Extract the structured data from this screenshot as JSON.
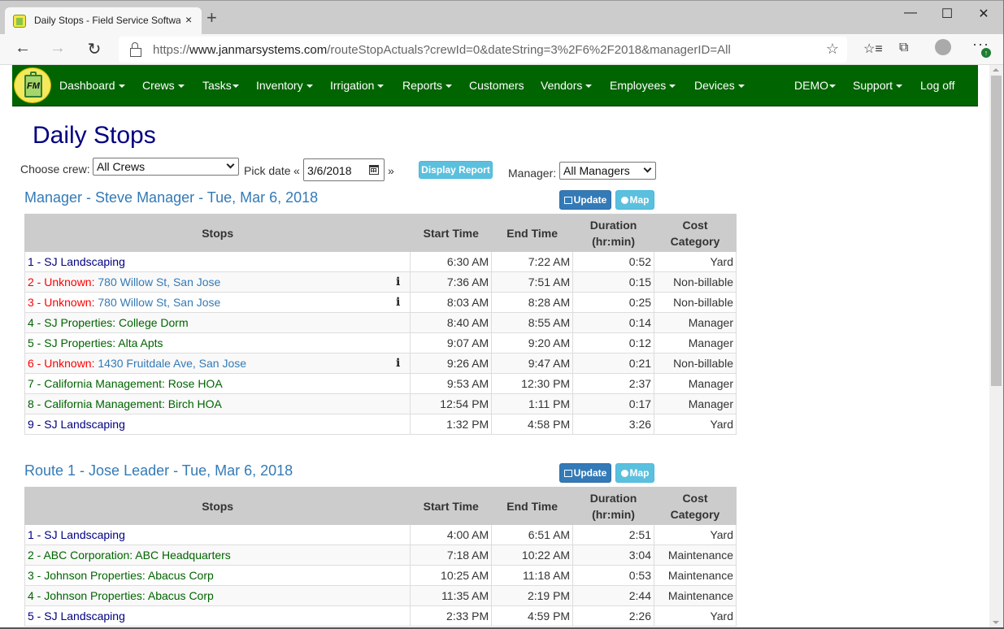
{
  "browser": {
    "tab_title": "Daily Stops - Field Service Software",
    "new_tab": "+",
    "close_tab": "×",
    "window": {
      "minimize": "—",
      "maximize": "☐",
      "close": "✕"
    },
    "nav": {
      "back": "←",
      "forward": "→",
      "reload": "↻"
    },
    "url_scheme": "https://",
    "url_host": "www.janmarsystems.com",
    "url_path": "/routeStopActuals?crewId=0&dateString=3%2F6%2F2018&managerID=All",
    "favorite_icon": "☆",
    "favorites_bar_icon": "☆≡",
    "collections_icon": "⧉",
    "more": "···",
    "update_badge": "↑"
  },
  "navbar": {
    "logo_text": "FM",
    "items": [
      {
        "label": "Dashboard",
        "dropdown": true
      },
      {
        "label": "Crews",
        "dropdown": true
      },
      {
        "label": "Tasks",
        "dropdown": true
      },
      {
        "label": "Inventory",
        "dropdown": true
      },
      {
        "label": "Irrigation",
        "dropdown": true
      },
      {
        "label": "Reports",
        "dropdown": true
      },
      {
        "label": "Customers",
        "dropdown": false
      },
      {
        "label": "Vendors",
        "dropdown": true
      },
      {
        "label": "Employees",
        "dropdown": true
      },
      {
        "label": "Devices",
        "dropdown": true
      },
      {
        "label": "DEMO",
        "dropdown": true
      },
      {
        "label": "Support",
        "dropdown": true
      },
      {
        "label": "Log off",
        "dropdown": false
      }
    ],
    "color": "#006400"
  },
  "page": {
    "title": "Daily Stops",
    "filters": {
      "crew_label": "Choose crew:",
      "crew_value": "All Crews",
      "date_label": "Pick date",
      "prev_arrow": "«",
      "next_arrow": "»",
      "date_value": "3/6/2018",
      "display_button": "Display Report",
      "manager_label": "Manager:",
      "manager_value": "All Managers"
    }
  },
  "table_headers": {
    "stops": "Stops",
    "start": "Start Time",
    "end": "End Time",
    "duration_1": "Duration",
    "duration_2": "(hr:min)",
    "cost_1": "Cost",
    "cost_2": "Category"
  },
  "sections": [
    {
      "title": "Manager - Steve Manager - Tue, Mar 6, 2018",
      "update_label": "Update",
      "map_label": "Map",
      "rows": [
        {
          "type": "yard",
          "prefix": "1 - SJ Landscaping",
          "detail": "",
          "info": false,
          "start": "6:30 AM",
          "end": "7:22 AM",
          "duration": "0:52",
          "category": "Yard"
        },
        {
          "type": "unknown",
          "prefix": "2 - Unknown:",
          "detail": " 780 Willow St, San Jose",
          "info": true,
          "start": "7:36 AM",
          "end": "7:51 AM",
          "duration": "0:15",
          "category": "Non-billable"
        },
        {
          "type": "unknown",
          "prefix": "3 - Unknown:",
          "detail": " 780 Willow St, San Jose",
          "info": true,
          "start": "8:03 AM",
          "end": "8:28 AM",
          "duration": "0:25",
          "category": "Non-billable"
        },
        {
          "type": "customer",
          "prefix": "4 - SJ Properties:  College Dorm",
          "detail": "",
          "info": false,
          "start": "8:40 AM",
          "end": "8:55 AM",
          "duration": "0:14",
          "category": "Manager"
        },
        {
          "type": "customer",
          "prefix": "5 - SJ Properties:  Alta Apts",
          "detail": "",
          "info": false,
          "start": "9:07 AM",
          "end": "9:20 AM",
          "duration": "0:12",
          "category": "Manager"
        },
        {
          "type": "unknown",
          "prefix": "6 - Unknown:",
          "detail": " 1430 Fruitdale Ave, San Jose",
          "info": true,
          "start": "9:26 AM",
          "end": "9:47 AM",
          "duration": "0:21",
          "category": "Non-billable"
        },
        {
          "type": "customer",
          "prefix": "7 - California Management:  Rose HOA",
          "detail": "",
          "info": false,
          "start": "9:53 AM",
          "end": "12:30 PM",
          "duration": "2:37",
          "category": "Manager"
        },
        {
          "type": "customer",
          "prefix": "8 - California Management:  Birch HOA",
          "detail": "",
          "info": false,
          "start": "12:54 PM",
          "end": "1:11 PM",
          "duration": "0:17",
          "category": "Manager"
        },
        {
          "type": "yard",
          "prefix": "9 - SJ Landscaping",
          "detail": "",
          "info": false,
          "start": "1:32 PM",
          "end": "4:58 PM",
          "duration": "3:26",
          "category": "Yard"
        }
      ]
    },
    {
      "title": "Route 1 - Jose Leader - Tue, Mar 6, 2018",
      "update_label": "Update",
      "map_label": "Map",
      "rows": [
        {
          "type": "yard",
          "prefix": "1 - SJ Landscaping",
          "detail": "",
          "info": false,
          "start": "4:00 AM",
          "end": "6:51 AM",
          "duration": "2:51",
          "category": "Yard"
        },
        {
          "type": "customer",
          "prefix": "2 - ABC Corporation:  ABC Headquarters",
          "detail": "",
          "info": false,
          "start": "7:18 AM",
          "end": "10:22 AM",
          "duration": "3:04",
          "category": "Maintenance"
        },
        {
          "type": "customer",
          "prefix": "3 - Johnson Properties:  Abacus Corp",
          "detail": "",
          "info": false,
          "start": "10:25 AM",
          "end": "11:18 AM",
          "duration": "0:53",
          "category": "Maintenance"
        },
        {
          "type": "customer",
          "prefix": "4 - Johnson Properties:  Abacus Corp",
          "detail": "",
          "info": false,
          "start": "11:35 AM",
          "end": "2:19 PM",
          "duration": "2:44",
          "category": "Maintenance"
        },
        {
          "type": "yard",
          "prefix": "5 - SJ Landscaping",
          "detail": "",
          "info": false,
          "start": "2:33 PM",
          "end": "4:59 PM",
          "duration": "2:26",
          "category": "Yard"
        }
      ]
    }
  ],
  "info_icon": "i"
}
